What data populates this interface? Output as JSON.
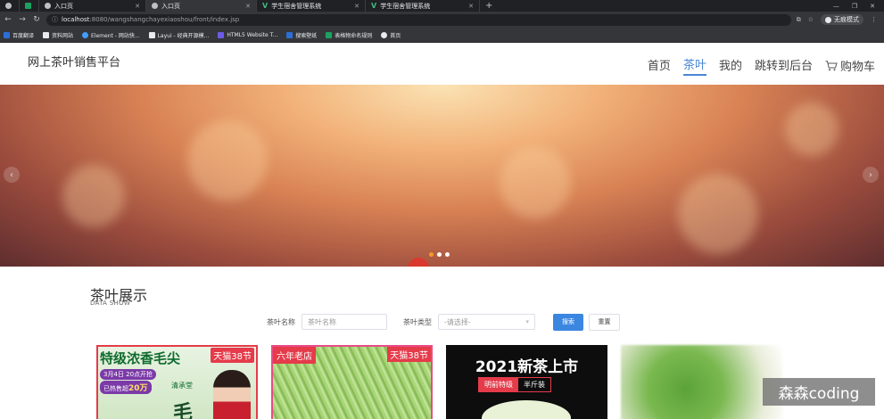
{
  "browser": {
    "tabs": [
      {
        "title": "",
        "favicon": "globe-icon",
        "active": false
      },
      {
        "title": "入口页",
        "favicon": "globe-icon",
        "active": false
      },
      {
        "title": "入口页",
        "favicon": "globe-icon",
        "active": true
      },
      {
        "title": "学生宿舍管理系统",
        "favicon": "vue-icon",
        "active": false
      },
      {
        "title": "学生宿舍管理系统",
        "favicon": "vue-icon",
        "active": false
      }
    ],
    "url_host": "localhost",
    "url_path": ":8080/wangshangchayexiaoshou/front/index.jsp",
    "incognito_label": "无痕模式",
    "bookmarks": [
      {
        "label": "百度翻译",
        "color": "#2b6fd6"
      },
      {
        "label": "资料网站",
        "color": "#e8eaed"
      },
      {
        "label": "Element - 网站快...",
        "color": "#409eff"
      },
      {
        "label": "Layui - 经典开源模...",
        "color": "#e8eaed"
      },
      {
        "label": "HTML5 Website T...",
        "color": "#6c5ce7"
      },
      {
        "label": "搜索壁纸",
        "color": "#2b6fd6"
      },
      {
        "label": "表格物命名规则",
        "color": "#1aa260"
      },
      {
        "label": "首页",
        "color": "#e8eaed"
      }
    ]
  },
  "site": {
    "title": "网上茶叶销售平台",
    "nav": [
      {
        "label": "首页",
        "active": false
      },
      {
        "label": "茶叶",
        "active": true
      },
      {
        "label": "我的",
        "active": false
      },
      {
        "label": "跳转到后台",
        "active": false
      }
    ],
    "cart_label": "购物车"
  },
  "banner": {
    "active_index": 0,
    "slide_count": 3
  },
  "section": {
    "title": "茶叶展示",
    "subtitle": "DATA SHOW"
  },
  "search": {
    "name_label": "茶叶名称",
    "name_placeholder": "茶叶名称",
    "type_label": "茶叶类型",
    "type_placeholder": "-请选择-",
    "search_button": "搜索",
    "reset_button": "重置"
  },
  "products": [
    {
      "headline": "特级浓香毛尖",
      "badge": "天猫38节",
      "pill1": "3月4日 20点开抢",
      "pill2_prefix": "已热售超",
      "pill2_value": "20万",
      "brand": "清承堂",
      "char": "毛"
    },
    {
      "tag": "六年老店",
      "badge": "天猫38节"
    },
    {
      "headline": "2021新茶上市",
      "pill1": "明前特级",
      "pill2": "半斤装"
    },
    {}
  ],
  "watermark": "森森coding"
}
